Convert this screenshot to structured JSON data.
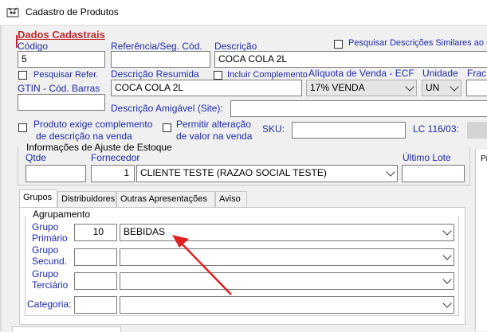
{
  "window": {
    "title": "Cadastro de Produtos",
    "icon": "app-icon"
  },
  "section_title": "Dados Cadastrais",
  "fields": {
    "codigo": {
      "label": "Código",
      "value": "5"
    },
    "referencia": {
      "label": "Referência/Seg. Cód.",
      "value": ""
    },
    "descricao": {
      "label": "Descrição",
      "value": "COCA COLA 2L"
    },
    "pesquisar_similares": {
      "label": "Pesquisar Descrições Similares ao D",
      "checked": false
    },
    "pesquisar_refer": {
      "label": "Pesquisar Refer.",
      "checked": false
    },
    "descricao_resumida": {
      "label": "Descrição Resumida",
      "value": "COCA COLA 2L"
    },
    "incluir_complemento": {
      "label": "Incluir Complemento",
      "checked": false
    },
    "aliquota": {
      "label": "Alíquota de Venda - ECF",
      "value": "17% VENDA"
    },
    "unidade": {
      "label": "Unidade",
      "value": "UN"
    },
    "fracao": {
      "label": "Frac"
    },
    "gtin": {
      "label": "GTIN - Cód. Barras",
      "value": ""
    },
    "descricao_amigavel": {
      "label": "Descrição Amigável (Site):",
      "value": ""
    },
    "exige_complemento": {
      "label_line1": "Produto exige complemento",
      "label_line2": "de descrição na venda",
      "checked": false
    },
    "permitir_alteracao": {
      "label_line1": "Permitir alteração",
      "label_line2": "de valor na venda",
      "checked": false
    },
    "sku": {
      "label": "SKU:",
      "value": ""
    },
    "lc": {
      "label": "LC 116/03:"
    }
  },
  "ajuste_estoque": {
    "title": "Informações de Ajuste de Estoque",
    "qtde_label": "Qtde",
    "qtde_value": "",
    "fornecedor_label": "Fornecedor",
    "fornecedor_code": "1",
    "fornecedor_name": "CLIENTE TESTE (RAZAO SOCIAL TESTE)",
    "ultimo_lote_label": "Último Lote",
    "ultimo_lote_value": ""
  },
  "right_panel_label": "Pr",
  "tabs": [
    {
      "label": "Grupos",
      "active": true
    },
    {
      "label": "Distribuidores",
      "active": false
    },
    {
      "label": "Outras Apresentações",
      "active": false
    },
    {
      "label": "Aviso",
      "active": false
    }
  ],
  "agrupamento": {
    "title": "Agrupamento",
    "grupo_primario": {
      "label_line1": "Grupo",
      "label_line2": "Primário",
      "code": "10",
      "value": "BEBIDAS"
    },
    "grupo_secundario": {
      "label_line1": "Grupo",
      "label_line2": "Secund.",
      "code": "",
      "value": ""
    },
    "grupo_terciario": {
      "label_line1": "Grupo",
      "label_line2": "Terciário",
      "code": "",
      "value": ""
    },
    "categoria": {
      "label": "Categoria:",
      "value": ""
    }
  },
  "annotation": {
    "type": "arrow",
    "color": "#e02020"
  }
}
